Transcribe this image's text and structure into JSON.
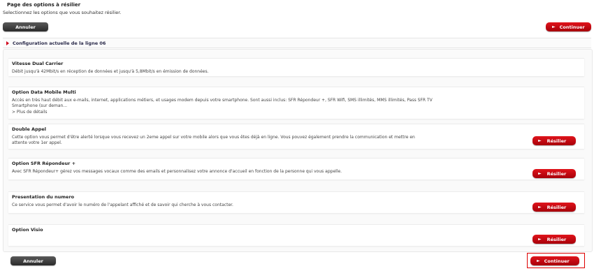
{
  "page": {
    "title": "Page des options à résilier",
    "subtitle": "Selectionnez les options que vous souhaitez résilier."
  },
  "buttons": {
    "annuler": "Annuler",
    "continuer": "Continuer",
    "resilier": "Résilier"
  },
  "section": {
    "title": "Configuration actuelle de la ligne 06"
  },
  "options": [
    {
      "title": "Vitesse Dual Carrier",
      "description": "Débit jusqu'à 42Mbit/s en réception de données et jusqu'à 5,8Mbit/s en émission de données."
    },
    {
      "title": "Option Data Mobile Multi",
      "description": "Accès en très haut débit aux e-mails, internet, applications métiers, et usages modem depuis votre smartphone. Sont aussi inclus: SFR Répondeur +, SFR Wifi, SMS illimités, MMS illimités, Pass SFR TV Smartphone (sur deman...",
      "more": "> Plus de détails"
    },
    {
      "title": "Double Appel",
      "description": "Cette option vous permet d'être alerté lorsque vous recevez un 2eme appel sur votre mobile alors que vous êtes déjà en ligne. Vous pouvez également prendre la communication et mettre en attente votre 1er appel."
    },
    {
      "title": "Option SFR Répondeur +",
      "description": "Avec SFR Répondeur+ gérez vos messages vocaux comme des emails et personnalisez votre annonce d'accueil en fonction de la personne qui vous appelle."
    },
    {
      "title": "Presentation du numero",
      "description": "Ce service vous permet d'avoir le numéro de l'appelant affiché et de savoir qui cherche à vous contacter."
    },
    {
      "title": "Option Visio",
      "description": ""
    }
  ],
  "colors": {
    "brand_red": "#d0001a",
    "dark_button": "#333333"
  },
  "icons": {
    "section_arrow": "arrow-right-icon",
    "button_chevron": "chevron-right-icon"
  }
}
